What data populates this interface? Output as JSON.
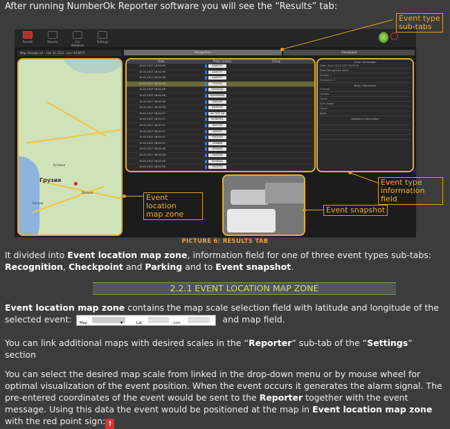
{
  "intro": "After running NumberOk Reporter software you will see the “Results” tab:",
  "figure": {
    "nav": [
      "Results",
      "Reports",
      "Car database",
      "Settings"
    ],
    "coords": "Lat: 41.2521 - Lon: 44.8972",
    "map_select": "Map: Georgia all",
    "map_labels": [
      "Грузия",
      "Тбилиси",
      "Батуми",
      "Кутаиси"
    ],
    "tabs": [
      "Recognition",
      "Checkpoint"
    ],
    "table_headers": [
      "Date",
      "Plate number",
      "Group"
    ],
    "rows": [
      {
        "date": "19.01.2017 16:01:54",
        "plate": "AA497YY"
      },
      {
        "date": "19.01.2017 16:01:56",
        "plate": "AA497YY"
      },
      {
        "date": "19.01.2017 16:01:56",
        "plate": "AA497YY"
      },
      {
        "date": "19.01.2017 16:01:56",
        "plate": "FS97OS"
      },
      {
        "date": "19.01.2017 16:01:56",
        "plate": "IS0503QQ"
      },
      {
        "date": "19.01.2017 16:01:56",
        "plate": "BB9994WW"
      },
      {
        "date": "19.01.2017 16:01:56",
        "plate": "QW5290"
      },
      {
        "date": "19.01.2017 16:01:56",
        "plate": "DD983VV"
      },
      {
        "date": "19.01.2017 16:01:57",
        "plate": "AA 7937 AA"
      },
      {
        "date": "19.01.2017 16:01:57",
        "plate": "KC0829RL"
      },
      {
        "date": "19.01.2017 16:01:57",
        "plate": "FA077SS"
      },
      {
        "date": "19.01.2017 16:01:57",
        "plate": "AZ4002"
      },
      {
        "date": "19.01.2017 16:01:57",
        "plate": "VM0395V"
      },
      {
        "date": "19.01.2017 16:01:57",
        "plate": "ZZ66NN"
      },
      {
        "date": "19.01.2017 16:01:58",
        "plate": "DP5490F"
      },
      {
        "date": "19.01.2017 16:01:58",
        "plate": "AA0083II"
      },
      {
        "date": "19.01.2017 16:01:58",
        "plate": "BV0834A"
      },
      {
        "date": "19.01.2017 16:01:58",
        "plate": "YOC379V"
      }
    ],
    "info_title": "Event information",
    "info_lines": [
      "Date / Time  19.01.2017 16:01:54",
      "Event  Recognition alarm",
      "Number  1",
      "Channel  1 / 1"
    ],
    "basic_title": "Basic information",
    "basic_lines": [
      "Channel",
      "Country",
      "Owner",
      "Car's model",
      "Owner",
      "Notes"
    ],
    "additional_title": "Additional information"
  },
  "callouts": {
    "subtabs": "Event type\nsub-tabs",
    "info_field": "Event type\ninformation field",
    "map_zone": "Event location\nmap zone",
    "snapshot": "Event snapshot"
  },
  "caption": "PICTURE 6: RESULTS TAB",
  "para1": {
    "a": "It divided into ",
    "b1": "Event location map zone",
    "c": ", information field for one of three event types sub-tabs: ",
    "b2": "Recognition",
    "d": ", ",
    "b3": "Checkpoint",
    "e": " and ",
    "b4": "Parking",
    "f": " and to ",
    "b5": "Event snapshot",
    "g": "."
  },
  "section_title": "2.2.1  EVENT LOCATION MAP ZONE",
  "para2": {
    "b1": "Event location map zone",
    "a": " contains the map scale selection field with latitude and longitude of the selected event:",
    "sel_map": "Map",
    "sel_lat": "Lat:",
    "sel_lon": "- Lon:",
    "b": " and map field."
  },
  "para3": {
    "a": "You can link additional maps with desired scales in the “",
    "b1": "Reporter",
    "c": "” sub-tab of the “",
    "b2": "Settings",
    "d": "” section"
  },
  "para4": {
    "a": "You can select the desired map scale from linked in the drop-down menu or by mouse wheel for optimal visualization of the event position. When the event occurs it generates the alarm signal. The pre-entered coordinates of the event would be sent to the ",
    "b1": "Reporter",
    "c": " together with the event message. Using this data the event would be positioned at the map in ",
    "b2": "Event location map zone",
    "d": " with the red point sign:",
    "alarm_icon": "!"
  }
}
